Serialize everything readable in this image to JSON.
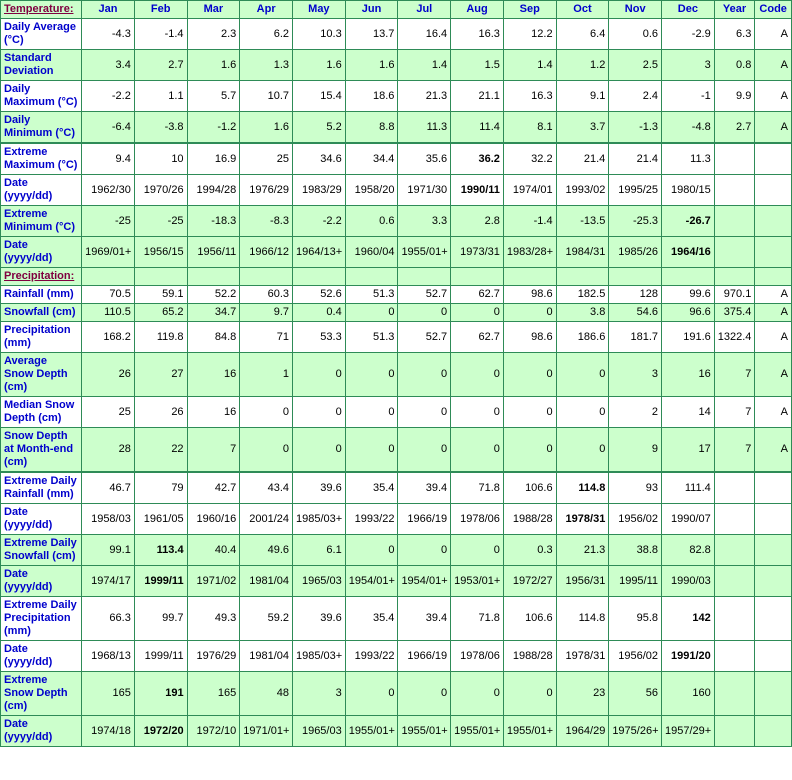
{
  "table": {
    "section_temperature_label": "Temperature:",
    "section_precipitation_label": "Precipitation:",
    "columns": [
      "Jan",
      "Feb",
      "Mar",
      "Apr",
      "May",
      "Jun",
      "Jul",
      "Aug",
      "Sep",
      "Oct",
      "Nov",
      "Dec",
      "Year",
      "Code"
    ],
    "colors": {
      "border": "#2e8b57",
      "row_green": "#ccffcc",
      "row_white": "#ffffff",
      "label_text": "#0000cc",
      "section_text": "#800040",
      "value_text": "#000000"
    },
    "rows": [
      {
        "label": "Daily Average (°C)",
        "shade": "white",
        "values": [
          "-4.3",
          "-1.4",
          "2.3",
          "6.2",
          "10.3",
          "13.7",
          "16.4",
          "16.3",
          "12.2",
          "6.4",
          "0.6",
          "-2.9",
          "6.3",
          "A"
        ],
        "bold": []
      },
      {
        "label": "Standard Deviation",
        "shade": "green",
        "values": [
          "3.4",
          "2.7",
          "1.6",
          "1.3",
          "1.6",
          "1.6",
          "1.4",
          "1.5",
          "1.4",
          "1.2",
          "2.5",
          "3",
          "0.8",
          "A"
        ],
        "bold": []
      },
      {
        "label": "Daily Maximum (°C)",
        "shade": "white",
        "values": [
          "-2.2",
          "1.1",
          "5.7",
          "10.7",
          "15.4",
          "18.6",
          "21.3",
          "21.1",
          "16.3",
          "9.1",
          "2.4",
          "-1",
          "9.9",
          "A"
        ],
        "bold": []
      },
      {
        "label": "Daily Minimum (°C)",
        "shade": "green",
        "values": [
          "-6.4",
          "-3.8",
          "-1.2",
          "1.6",
          "5.2",
          "8.8",
          "11.3",
          "11.4",
          "8.1",
          "3.7",
          "-1.3",
          "-4.8",
          "2.7",
          "A"
        ],
        "bold": []
      },
      {
        "label": "Extreme Maximum (°C)",
        "shade": "white",
        "thicktop": true,
        "values": [
          "9.4",
          "10",
          "16.9",
          "25",
          "34.6",
          "34.4",
          "35.6",
          "36.2",
          "32.2",
          "21.4",
          "21.4",
          "11.3",
          "",
          ""
        ],
        "bold": [
          7
        ]
      },
      {
        "label": "Date (yyyy/dd)",
        "shade": "white",
        "values": [
          "1962/30",
          "1970/26",
          "1994/28",
          "1976/29",
          "1983/29",
          "1958/20",
          "1971/30",
          "1990/11",
          "1974/01",
          "1993/02",
          "1995/25",
          "1980/15",
          "",
          ""
        ],
        "bold": [
          7
        ]
      },
      {
        "label": "Extreme Minimum (°C)",
        "shade": "green",
        "values": [
          "-25",
          "-25",
          "-18.3",
          "-8.3",
          "-2.2",
          "0.6",
          "3.3",
          "2.8",
          "-1.4",
          "-13.5",
          "-25.3",
          "-26.7",
          "",
          ""
        ],
        "bold": [
          11
        ]
      },
      {
        "label": "Date (yyyy/dd)",
        "shade": "green",
        "values": [
          "1969/01+",
          "1956/15",
          "1956/11",
          "1966/12",
          "1964/13+",
          "1960/04",
          "1955/01+",
          "1973/31",
          "1983/28+",
          "1984/31",
          "1985/26",
          "1964/16",
          "",
          ""
        ],
        "bold": [
          11
        ]
      },
      {
        "label": "Rainfall (mm)",
        "shade": "white",
        "values": [
          "70.5",
          "59.1",
          "52.2",
          "60.3",
          "52.6",
          "51.3",
          "52.7",
          "62.7",
          "98.6",
          "182.5",
          "128",
          "99.6",
          "970.1",
          "A"
        ],
        "bold": []
      },
      {
        "label": "Snowfall (cm)",
        "shade": "green",
        "values": [
          "110.5",
          "65.2",
          "34.7",
          "9.7",
          "0.4",
          "0",
          "0",
          "0",
          "0",
          "3.8",
          "54.6",
          "96.6",
          "375.4",
          "A"
        ],
        "bold": []
      },
      {
        "label": "Precipitation (mm)",
        "shade": "white",
        "values": [
          "168.2",
          "119.8",
          "84.8",
          "71",
          "53.3",
          "51.3",
          "52.7",
          "62.7",
          "98.6",
          "186.6",
          "181.7",
          "191.6",
          "1322.4",
          "A"
        ],
        "bold": []
      },
      {
        "label": "Average Snow Depth (cm)",
        "shade": "green",
        "values": [
          "26",
          "27",
          "16",
          "1",
          "0",
          "0",
          "0",
          "0",
          "0",
          "0",
          "3",
          "16",
          "7",
          "A"
        ],
        "bold": []
      },
      {
        "label": "Median Snow Depth (cm)",
        "shade": "white",
        "values": [
          "25",
          "26",
          "16",
          "0",
          "0",
          "0",
          "0",
          "0",
          "0",
          "0",
          "2",
          "14",
          "7",
          "A"
        ],
        "bold": []
      },
      {
        "label": "Snow Depth at Month-end (cm)",
        "shade": "green",
        "values": [
          "28",
          "22",
          "7",
          "0",
          "0",
          "0",
          "0",
          "0",
          "0",
          "0",
          "9",
          "17",
          "7",
          "A"
        ],
        "bold": []
      },
      {
        "label": "Extreme Daily Rainfall (mm)",
        "shade": "white",
        "thicktop": true,
        "values": [
          "46.7",
          "79",
          "42.7",
          "43.4",
          "39.6",
          "35.4",
          "39.4",
          "71.8",
          "106.6",
          "114.8",
          "93",
          "111.4",
          "",
          ""
        ],
        "bold": [
          9
        ]
      },
      {
        "label": "Date (yyyy/dd)",
        "shade": "white",
        "values": [
          "1958/03",
          "1961/05",
          "1960/16",
          "2001/24",
          "1985/03+",
          "1993/22",
          "1966/19",
          "1978/06",
          "1988/28",
          "1978/31",
          "1956/02",
          "1990/07",
          "",
          ""
        ],
        "bold": [
          9
        ]
      },
      {
        "label": "Extreme Daily Snowfall (cm)",
        "shade": "green",
        "values": [
          "99.1",
          "113.4",
          "40.4",
          "49.6",
          "6.1",
          "0",
          "0",
          "0",
          "0.3",
          "21.3",
          "38.8",
          "82.8",
          "",
          ""
        ],
        "bold": [
          1
        ]
      },
      {
        "label": "Date (yyyy/dd)",
        "shade": "green",
        "values": [
          "1974/17",
          "1999/11",
          "1971/02",
          "1981/04",
          "1965/03",
          "1954/01+",
          "1954/01+",
          "1953/01+",
          "1972/27",
          "1956/31",
          "1995/11",
          "1990/03",
          "",
          ""
        ],
        "bold": [
          1
        ]
      },
      {
        "label": "Extreme Daily Precipitation (mm)",
        "shade": "white",
        "values": [
          "66.3",
          "99.7",
          "49.3",
          "59.2",
          "39.6",
          "35.4",
          "39.4",
          "71.8",
          "106.6",
          "114.8",
          "95.8",
          "142",
          "",
          ""
        ],
        "bold": [
          11
        ]
      },
      {
        "label": "Date (yyyy/dd)",
        "shade": "white",
        "values": [
          "1968/13",
          "1999/11",
          "1976/29",
          "1981/04",
          "1985/03+",
          "1993/22",
          "1966/19",
          "1978/06",
          "1988/28",
          "1978/31",
          "1956/02",
          "1991/20",
          "",
          ""
        ],
        "bold": [
          11
        ]
      },
      {
        "label": "Extreme Snow Depth (cm)",
        "shade": "green",
        "values": [
          "165",
          "191",
          "165",
          "48",
          "3",
          "0",
          "0",
          "0",
          "0",
          "23",
          "56",
          "160",
          "",
          ""
        ],
        "bold": [
          1
        ]
      },
      {
        "label": "Date (yyyy/dd)",
        "shade": "green",
        "values": [
          "1974/18",
          "1972/20",
          "1972/10",
          "1971/01+",
          "1965/03",
          "1955/01+",
          "1955/01+",
          "1955/01+",
          "1955/01+",
          "1964/29",
          "1975/26+",
          "1957/29+",
          "",
          ""
        ],
        "bold": [
          1
        ]
      }
    ],
    "precipitation_section_after_row_index": 7
  }
}
